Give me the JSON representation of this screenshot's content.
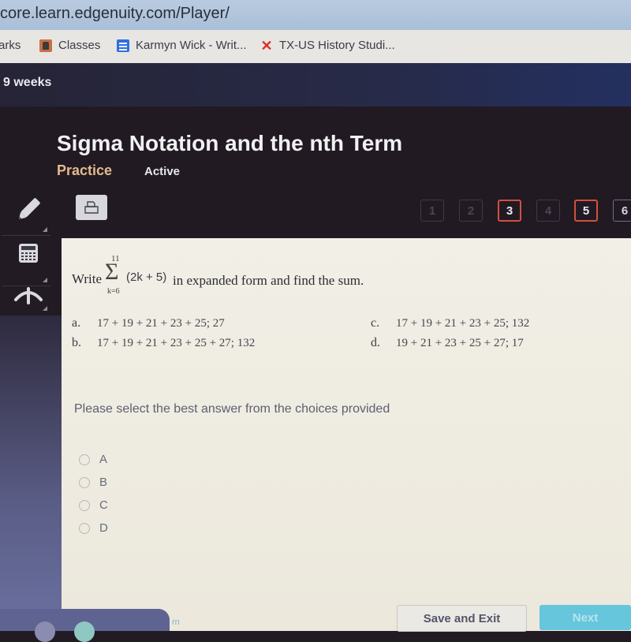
{
  "browser": {
    "url": "core.learn.edgenuity.com/Player/",
    "bookmarks": [
      {
        "label": "arks",
        "icon": "bookmark-folder-icon"
      },
      {
        "label": "Classes",
        "icon": "classroom-icon"
      },
      {
        "label": "Karmyn Wick - Writ...",
        "icon": "docs-icon"
      },
      {
        "label": "TX-US History Studi...",
        "icon": "x-logo-icon"
      }
    ]
  },
  "course": {
    "term": "9 weeks"
  },
  "lesson": {
    "title": "Sigma Notation and the nth Term",
    "mode": "Practice",
    "status": "Active"
  },
  "toolbar": {
    "tools": [
      "pencil-icon",
      "calculator-icon",
      "reference-icon"
    ],
    "print_icon": "print-icon"
  },
  "question_nav": [
    {
      "label": "1",
      "state": "disabled"
    },
    {
      "label": "2",
      "state": "disabled"
    },
    {
      "label": "3",
      "state": "current"
    },
    {
      "label": "4",
      "state": "disabled"
    },
    {
      "label": "5",
      "state": "flagged"
    },
    {
      "label": "6",
      "state": "available"
    }
  ],
  "question": {
    "prefix": "Write",
    "sigma_upper": "11",
    "sigma_symbol": "Σ",
    "sigma_lower": "k=6",
    "expression": "(2k + 5)",
    "suffix": "in expanded form and find the sum.",
    "choices": [
      {
        "letter": "a.",
        "text": "17 + 19 + 21 + 23 + 25; 27"
      },
      {
        "letter": "b.",
        "text": "17 + 19 + 21 + 23 + 25 + 27; 132"
      },
      {
        "letter": "c.",
        "text": "17 + 19 + 21 + 23 + 25; 132"
      },
      {
        "letter": "d.",
        "text": "19 + 21 + 23 + 25 + 27; 17"
      }
    ]
  },
  "answer": {
    "prompt": "Please select the best answer from the choices provided",
    "options": [
      "A",
      "B",
      "C",
      "D"
    ],
    "selected": null
  },
  "footer": {
    "save_label": "Save and Exit",
    "next_label": "Next",
    "link_partial": "rn"
  },
  "colors": {
    "accent_practice": "#e4b98e",
    "nav_flag": "#d0513e",
    "next_button": "#66c6dc"
  }
}
